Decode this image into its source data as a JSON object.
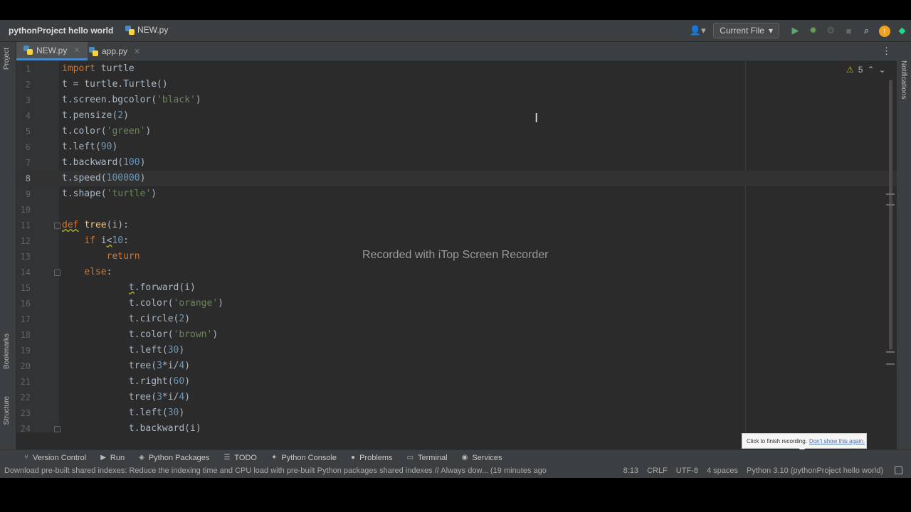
{
  "titlebar": {
    "project": "pythonProject hello world",
    "file": "NEW.py",
    "run_config": "Current File"
  },
  "sidebar_left": {
    "project": "Project",
    "bookmarks": "Bookmarks",
    "structure": "Structure"
  },
  "sidebar_right": {
    "notifications": "Notifications"
  },
  "tabs": [
    {
      "label": "NEW.py",
      "active": true
    },
    {
      "label": "app.py",
      "active": false
    }
  ],
  "editor": {
    "warning_count": "5",
    "watermark": "Recorded with iTop Screen Recorder",
    "lines": [
      {
        "n": "1",
        "code": "import turtle"
      },
      {
        "n": "2",
        "code": "t = turtle.Turtle()"
      },
      {
        "n": "3",
        "code": "t.screen.bgcolor('black')"
      },
      {
        "n": "4",
        "code": "t.pensize(2)"
      },
      {
        "n": "5",
        "code": "t.color('green')"
      },
      {
        "n": "6",
        "code": "t.left(90)"
      },
      {
        "n": "7",
        "code": "t.backward(100)"
      },
      {
        "n": "8",
        "code": "t.speed(100000)"
      },
      {
        "n": "9",
        "code": "t.shape('turtle')"
      },
      {
        "n": "10",
        "code": ""
      },
      {
        "n": "11",
        "code": "def tree(i):"
      },
      {
        "n": "12",
        "code": "    if i<10:"
      },
      {
        "n": "13",
        "code": "        return"
      },
      {
        "n": "14",
        "code": "    else:"
      },
      {
        "n": "15",
        "code": "            t.forward(i)"
      },
      {
        "n": "16",
        "code": "            t.color('orange')"
      },
      {
        "n": "17",
        "code": "            t.circle(2)"
      },
      {
        "n": "18",
        "code": "            t.color('brown')"
      },
      {
        "n": "19",
        "code": "            t.left(30)"
      },
      {
        "n": "20",
        "code": "            tree(3*i/4)"
      },
      {
        "n": "21",
        "code": "            t.right(60)"
      },
      {
        "n": "22",
        "code": "            tree(3*i/4)"
      },
      {
        "n": "23",
        "code": "            t.left(30)"
      },
      {
        "n": "24",
        "code": "            t.backward(i)"
      }
    ]
  },
  "tooltip": {
    "text": "Click to finish recording.",
    "link": "Don't show this again."
  },
  "toolwindows": [
    {
      "label": "Version Control",
      "icon": "branch-icon"
    },
    {
      "label": "Run",
      "icon": "run-icon"
    },
    {
      "label": "Python Packages",
      "icon": "packages-icon"
    },
    {
      "label": "TODO",
      "icon": "todo-icon"
    },
    {
      "label": "Python Console",
      "icon": "python-console-icon"
    },
    {
      "label": "Problems",
      "icon": "problems-icon"
    },
    {
      "label": "Terminal",
      "icon": "terminal-icon"
    },
    {
      "label": "Services",
      "icon": "services-icon"
    }
  ],
  "statusbar": {
    "message": "Download pre-built shared indexes: Reduce the indexing time and CPU load with pre-built Python packages shared indexes // Always dow... (19 minutes ago",
    "position": "8:13",
    "line_sep": "CRLF",
    "encoding": "UTF-8",
    "indent": "4 spaces",
    "interpreter": "Python 3.10 (pythonProject hello world)"
  }
}
